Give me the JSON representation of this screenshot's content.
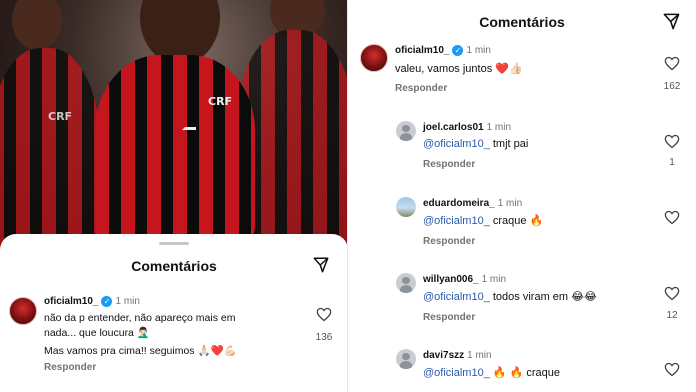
{
  "left_panel": {
    "jersey_emblem": "CRF",
    "sheet_title": "Comentários",
    "comment": {
      "username": "oficialm10_",
      "time": "1 min",
      "line1": "não da p entender, não apareço mais em",
      "line2": "nada... que loucura 🤦🏻‍♂️",
      "line3": "Mas vamos pra cima!! seguimos 🙏🏻❤️💪🏻",
      "reply_label": "Responder",
      "like_count": "136"
    }
  },
  "right_panel": {
    "sheet_title": "Comentários",
    "main_comment": {
      "username": "oficialm10_",
      "time": "1 min",
      "text": "valeu, vamos juntos ❤️👍🏻",
      "reply_label": "Responder",
      "like_count": "162"
    },
    "replies": [
      {
        "username": "joel.carlos01",
        "time": "1 min",
        "mention": "@oficialm10_",
        "text": "tmjt pai",
        "reply_label": "Responder",
        "like_count": "1"
      },
      {
        "username": "eduardomeira_",
        "time": "1 min",
        "mention": "@oficialm10_",
        "text": "craque 🔥",
        "reply_label": "Responder",
        "like_count": ""
      },
      {
        "username": "willyan006_",
        "time": "1 min",
        "mention": "@oficialm10_",
        "text": "todos viram em 😂😂",
        "reply_label": "Responder",
        "like_count": "12"
      },
      {
        "username": "davi7szz",
        "time": "1 min",
        "mention": "@oficialm10_",
        "text": "🔥 🔥 craque",
        "reply_label": "",
        "like_count": ""
      }
    ]
  },
  "colors": {
    "mention": "#2a5aa8",
    "verified": "#1d9bf0",
    "flamengo_red": "#c4161c"
  },
  "icons": {
    "share": "send-icon",
    "like": "heart-outline-icon",
    "verified": "verified-badge-icon"
  }
}
